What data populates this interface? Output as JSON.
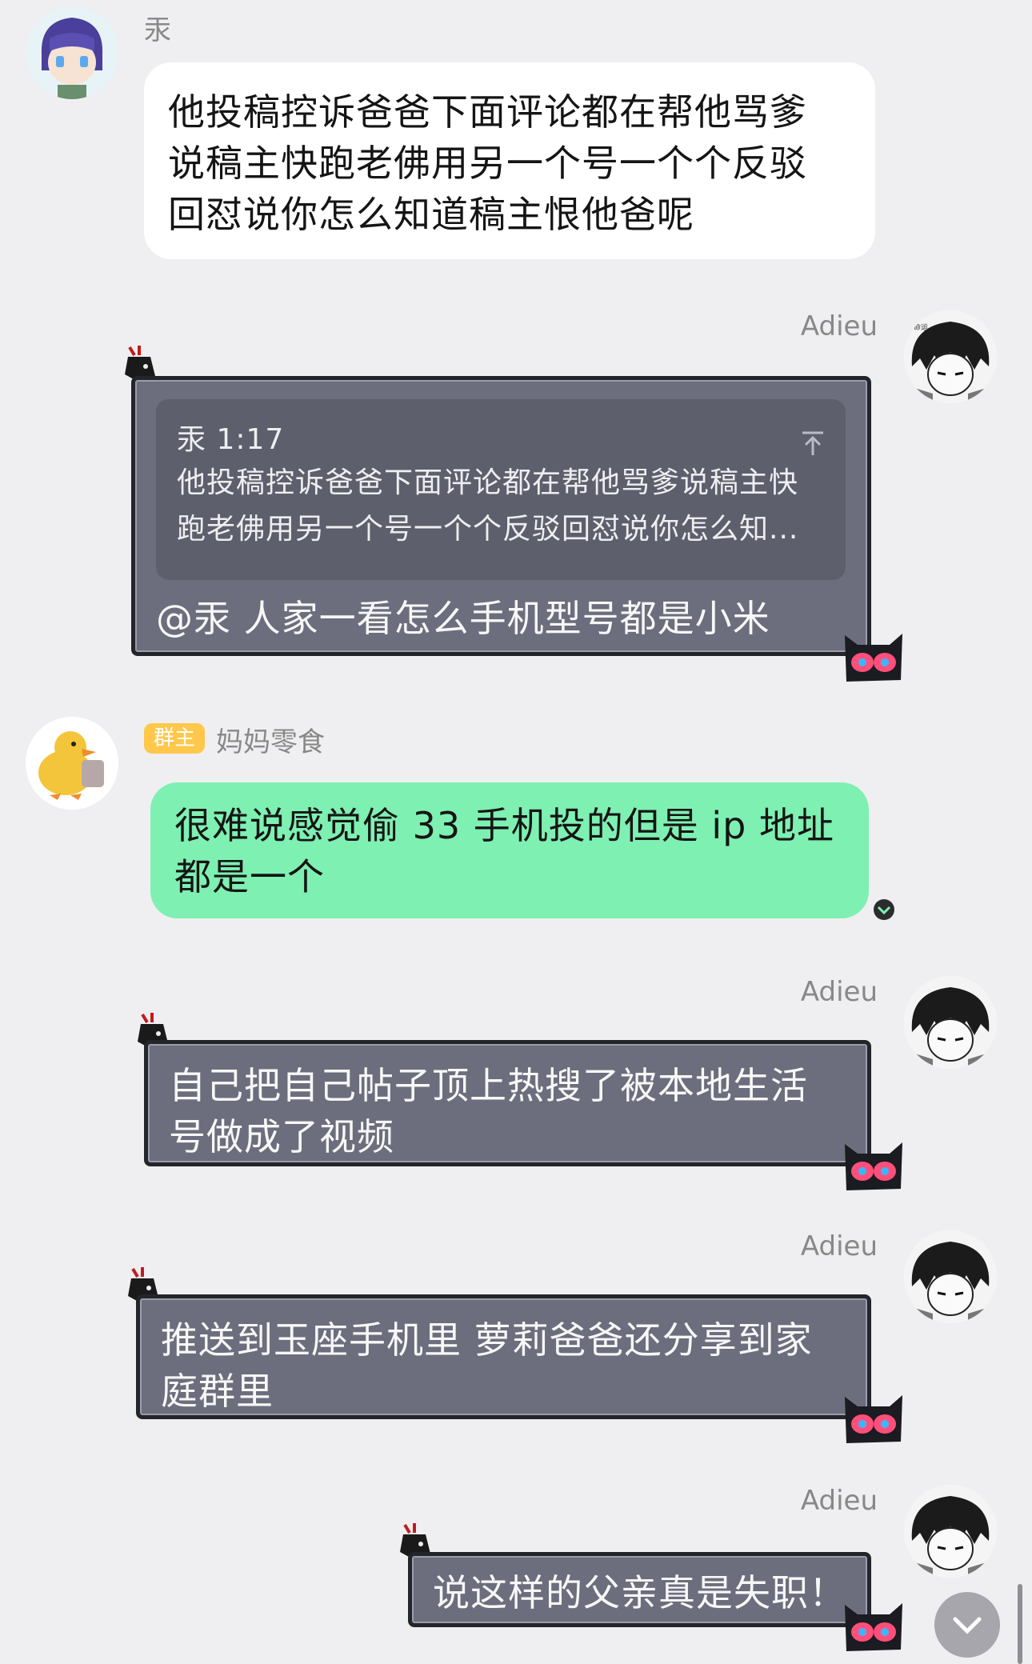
{
  "messages": [
    {
      "sender": "汞",
      "text_lines": [
        "他投稿控诉爸爸下面评论都在帮他骂爹",
        "说稿主快跑老佛用另一个号一个个反驳",
        "回怼说你怎么知道稿主恨他爸呢"
      ]
    },
    {
      "sender": "Adieu",
      "quote": {
        "header": "汞 1:17",
        "lines": [
          "他投稿控诉爸爸下面评论都在帮他骂爹说稿主快",
          "跑老佛用另一个号一个个反驳回怼说你怎么知..."
        ]
      },
      "text": "@汞 人家一看怎么手机型号都是小米"
    },
    {
      "badge": "群主",
      "sender": "妈妈零食",
      "text_lines": [
        "很难说感觉偷 33 手机投的但是 ip 地址",
        "都是一个"
      ]
    },
    {
      "sender": "Adieu",
      "text_lines": [
        "自己把自己帖子顶上热搜了被本地生活",
        "号做成了视频"
      ]
    },
    {
      "sender": "Adieu",
      "text_lines": [
        "推送到玉座手机里 萝莉爸爸还分享到家",
        "庭群里"
      ]
    },
    {
      "sender": "Adieu",
      "text": "说这样的父亲真是失职！"
    }
  ],
  "icons": {
    "avatar_1": "anime-character-avatar-icon",
    "avatar_adieu": "manga-boy-avatar-icon",
    "avatar_duck": "duck-avatar-icon",
    "bubble_top_decor": "black-figure-decor-icon",
    "bubble_bottom_decor": "cat-mask-decor-icon",
    "quote_jump": "jump-to-top-icon",
    "expand": "chevron-down-icon",
    "scroll_bottom": "chevron-down-icon"
  },
  "colors": {
    "background": "#efeff1",
    "bubble_white": "#ffffff",
    "bubble_green": "#7ef0b2",
    "bubble_dark": "#6c6e7d",
    "badge": "#ffc84a"
  }
}
